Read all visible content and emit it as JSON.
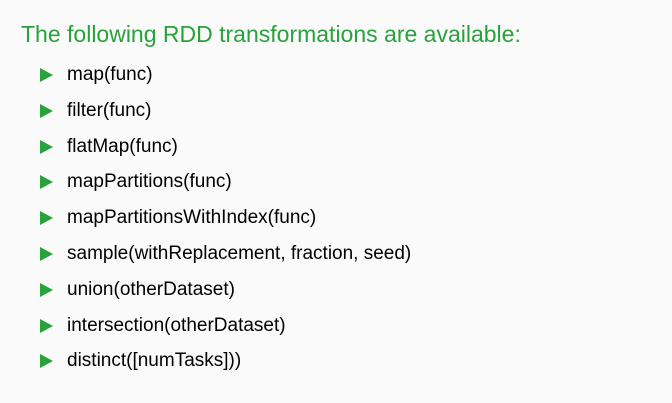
{
  "heading": "The following RDD transformations are available:",
  "items": [
    "map(func)",
    "filter(func)",
    "flatMap(func)",
    "mapPartitions(func)",
    "mapPartitionsWithIndex(func)",
    "sample(withReplacement, fraction, seed)",
    "union(otherDataset)",
    "intersection(otherDataset)",
    "distinct([numTasks]))"
  ],
  "colors": {
    "accent": "#28a23a",
    "text": "#000000",
    "background": "#fafafa"
  },
  "icons": {
    "bullet": "triangle-right-icon"
  }
}
